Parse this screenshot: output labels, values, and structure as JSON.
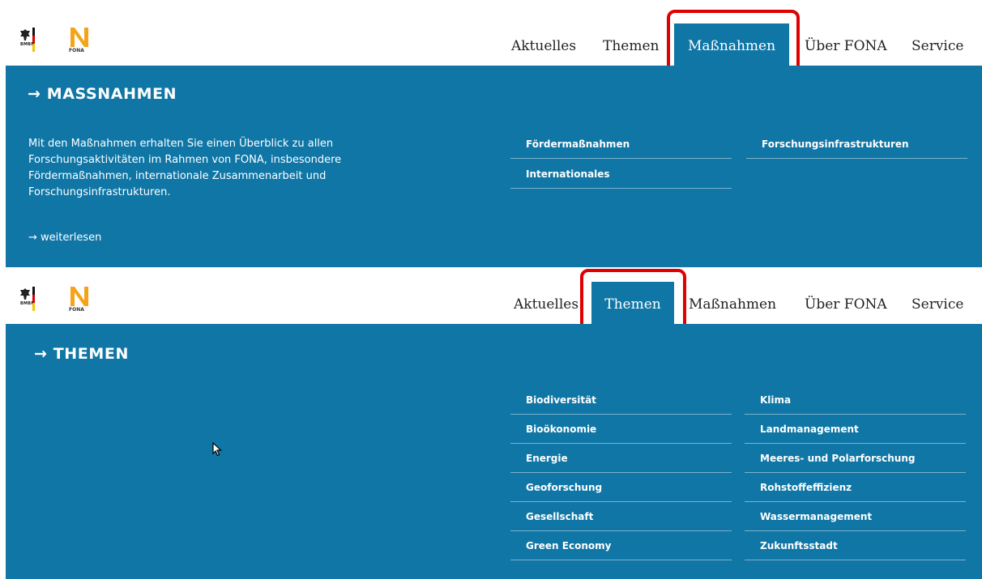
{
  "logos": {
    "bmbf_label": "BMBF",
    "fona_label": "FONA"
  },
  "screens": [
    {
      "nav": {
        "items": [
          "Aktuelles",
          "Themen",
          "Maßnahmen",
          "Über FONA",
          "Service"
        ],
        "active": "Maßnahmen"
      },
      "panel": {
        "title": "→ MASSNAHMEN",
        "description": "Mit den Maßnahmen erhalten Sie einen Überblick zu allen Forschungsaktivitäten im Rahmen von FONA, insbesondere Fördermaßnahmen, internationale Zusammenarbeit und Forschungsinfrastrukturen.",
        "more_link": "→ weiterlesen",
        "menu_left": [
          "Fördermaßnahmen",
          "Internationales"
        ],
        "menu_right": [
          "Forschungsinfrastrukturen"
        ]
      }
    },
    {
      "nav": {
        "items": [
          "Aktuelles",
          "Themen",
          "Maßnahmen",
          "Über FONA",
          "Service"
        ],
        "active": "Themen"
      },
      "panel": {
        "title": "→ THEMEN",
        "menu_left": [
          "Biodiversität",
          "Bioökonomie",
          "Energie",
          "Geoforschung",
          "Gesellschaft",
          "Green Economy"
        ],
        "menu_right": [
          "Klima",
          "Landmanagement",
          "Meeres- und Polarforschung",
          "Rohstoffeffizienz",
          "Wassermanagement",
          "Zukunftsstadt"
        ]
      }
    }
  ],
  "colors": {
    "panel_bg": "#0f76a6",
    "highlight": "#e00000",
    "fona_orange": "#f5a319"
  }
}
